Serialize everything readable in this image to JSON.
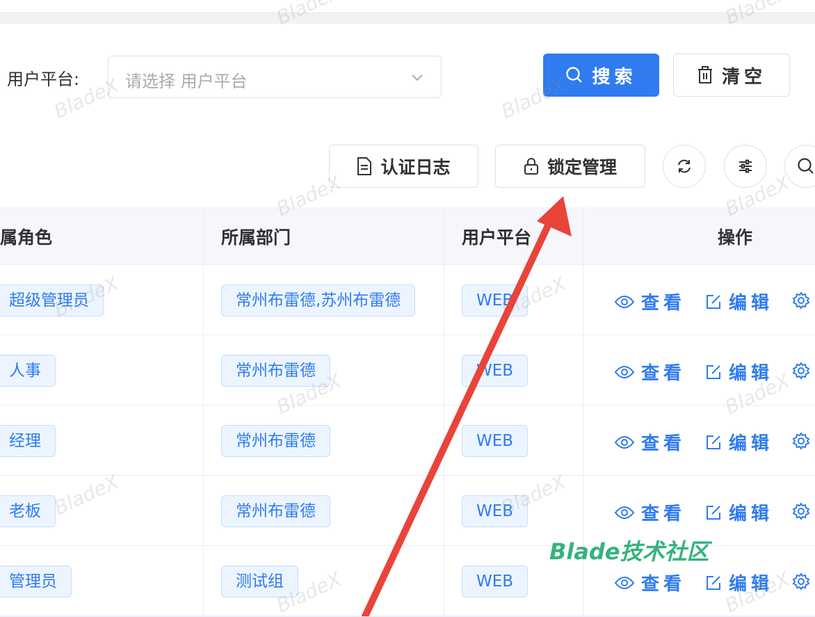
{
  "search": {
    "label": "用户平台:",
    "platform_placeholder": "请选择 用户平台",
    "search_button": "搜索",
    "clear_button": "清空"
  },
  "toolbar": {
    "auth_log_button": "认证日志",
    "lock_manage_button": "锁定管理",
    "refresh_icon": "refresh-icon",
    "columns_icon": "sliders-icon",
    "search_icon": "search-icon"
  },
  "table": {
    "headers": [
      "属角色",
      "所属部门",
      "用户平台",
      "操作"
    ],
    "rows": [
      {
        "role": "超级管理员",
        "dept": "常州布雷德,苏州布雷德",
        "platform": "WEB"
      },
      {
        "role": "人事",
        "dept": "常州布雷德",
        "platform": "WEB"
      },
      {
        "role": "经理",
        "dept": "常州布雷德",
        "platform": "WEB"
      },
      {
        "role": "老板",
        "dept": "常州布雷德",
        "platform": "WEB"
      },
      {
        "role": "管理员",
        "dept": "测试组",
        "platform": "WEB"
      }
    ],
    "actions": {
      "view": "查看",
      "edit": "编辑"
    }
  },
  "watermark": "BladeX",
  "community_label": "Blade技术社区",
  "colors": {
    "primary": "#2f7bef",
    "arrow": "#e8443a",
    "community": "#36b37e"
  }
}
